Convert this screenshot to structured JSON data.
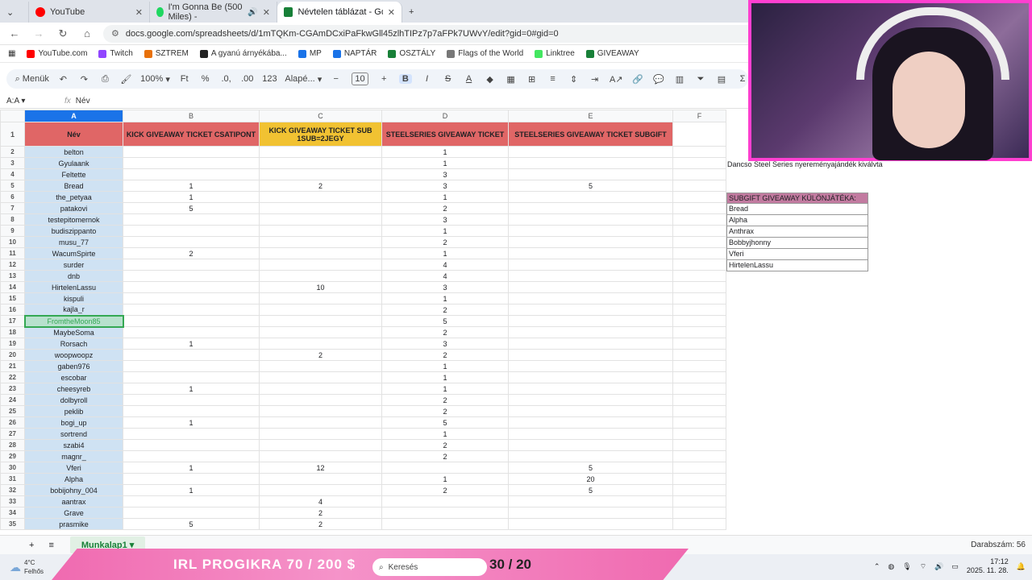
{
  "browser_tabs": [
    {
      "label": "YouTube",
      "color": "#ff0000"
    },
    {
      "label": "I'm Gonna Be (500 Miles) -",
      "color": "#1ed760"
    },
    {
      "label": "Névtelen táblázat - Google Tábl",
      "color": "#188038",
      "active": true
    }
  ],
  "address": {
    "url": "docs.google.com/spreadsheets/d/1mTQKm-CGAmDCxiPaFkwGll45zlhTIPz7p7aFPk7UWvY/edit?gid=0#gid=0"
  },
  "bookmarks": [
    {
      "label": "YouTube.com",
      "color": "#ff0000"
    },
    {
      "label": "Twitch",
      "color": "#9146ff"
    },
    {
      "label": "SZTREM",
      "color": "#e8710a"
    },
    {
      "label": "A gyanú árnyékába...",
      "color": "#222222"
    },
    {
      "label": "MP",
      "color": "#1a73e8"
    },
    {
      "label": "NAPTÁR",
      "color": "#1a73e8"
    },
    {
      "label": "OSZTÁLY",
      "color": "#188038"
    },
    {
      "label": "Flags of the World",
      "color": "#777777"
    },
    {
      "label": "Linktree",
      "color": "#43e660"
    },
    {
      "label": "GIVEAWAY",
      "color": "#188038"
    }
  ],
  "toolbar": {
    "menu": "Menük",
    "zoom": "100%",
    "ft": "Ft",
    "pct": "%",
    "dec1": ".0,",
    "dec2": ".00",
    "fmt123": "123",
    "font": "Alapé...",
    "font_size": "10"
  },
  "formula_bar": {
    "name_box": "A:A",
    "fx": "fx",
    "value": "Név"
  },
  "columns": [
    "A",
    "B",
    "C",
    "D",
    "E",
    "F"
  ],
  "headers": [
    "Név",
    "KICK GIVEAWAY TICKET CSATIPONT",
    "KICK GIVEAWAY TICKET SUB 1SUB=2JEGY",
    "STEELSERIES GIVEAWAY TICKET",
    "STEELSERIES GIVEAWAY TICKET SUBGIFT"
  ],
  "rows": [
    [
      "belton",
      "",
      "",
      "1",
      ""
    ],
    [
      "Gyulaank",
      "",
      "",
      "1",
      ""
    ],
    [
      "Feltette",
      "",
      "",
      "3",
      ""
    ],
    [
      "Bread",
      "1",
      "2",
      "3",
      "5"
    ],
    [
      "the_petyaa",
      "1",
      "",
      "1",
      ""
    ],
    [
      "patakovi",
      "5",
      "",
      "2",
      ""
    ],
    [
      "testepitomernok",
      "",
      "",
      "3",
      ""
    ],
    [
      "budiszippanto",
      "",
      "",
      "1",
      ""
    ],
    [
      "musu_77",
      "",
      "",
      "2",
      ""
    ],
    [
      "WacumSpirte",
      "2",
      "",
      "1",
      ""
    ],
    [
      "surder",
      "",
      "",
      "4",
      ""
    ],
    [
      "dnb",
      "",
      "",
      "4",
      ""
    ],
    [
      "HirtelenLassu",
      "",
      "10",
      "3",
      ""
    ],
    [
      "kispuli",
      "",
      "",
      "1",
      ""
    ],
    [
      "kajla_r",
      "",
      "",
      "2",
      ""
    ],
    [
      "FromtheMoon85",
      "",
      "",
      "5",
      ""
    ],
    [
      "MaybeSoma",
      "",
      "",
      "2",
      ""
    ],
    [
      "Rorsach",
      "1",
      "",
      "3",
      ""
    ],
    [
      "woopwoopz",
      "",
      "2",
      "2",
      ""
    ],
    [
      "gaben976",
      "",
      "",
      "1",
      ""
    ],
    [
      "escobar",
      "",
      "",
      "1",
      ""
    ],
    [
      "cheesyreb",
      "1",
      "",
      "1",
      ""
    ],
    [
      "dolbyroll",
      "",
      "",
      "2",
      ""
    ],
    [
      "peklib",
      "",
      "",
      "2",
      ""
    ],
    [
      "bogi_up",
      "1",
      "",
      "5",
      ""
    ],
    [
      "sortrend",
      "",
      "",
      "1",
      ""
    ],
    [
      "szabi4",
      "",
      "",
      "2",
      ""
    ],
    [
      "magnr_",
      "",
      "",
      "2",
      ""
    ],
    [
      "Vferi",
      "1",
      "12",
      "",
      "5"
    ],
    [
      "Alpha",
      "",
      "",
      "1",
      "20"
    ],
    [
      "bobijohny_004",
      "1",
      "",
      "2",
      "5"
    ],
    [
      "aantrax",
      "",
      "4",
      "",
      ""
    ],
    [
      "Grave",
      "",
      "2",
      "",
      ""
    ],
    [
      "prasmike",
      "5",
      "2",
      "",
      ""
    ]
  ],
  "side_note": "Dancso Steel Series nyereményajándék kiválvta",
  "subgift": {
    "title": "SUBGIFT GIVEAWAY KÜLÖNJÁTÉKA:",
    "names": [
      "Bread",
      "Alpha",
      "Anthrax",
      "Bobbyjhonny",
      "Vferi",
      "HirtelenLassu"
    ]
  },
  "sheet": {
    "tab": "Munkalap1",
    "count": "Darabszám: 56"
  },
  "taskbar": {
    "weather_temp": "4°C",
    "weather_desc": "Felhős",
    "banner": "IRL PROGIKRA 70 / 200 $",
    "counter": "30 / 20",
    "search": "Keresés",
    "time": "17:12",
    "date": "2025. 11. 28."
  },
  "colors": {
    "name_col": "#cfe2f3",
    "kick": "#e06666",
    "kick_sub": "#f1c232",
    "steel": "#e06666",
    "steel_sub": "#e06666",
    "subgift_header": "#c27ba0",
    "accent": "#1a73e8"
  }
}
